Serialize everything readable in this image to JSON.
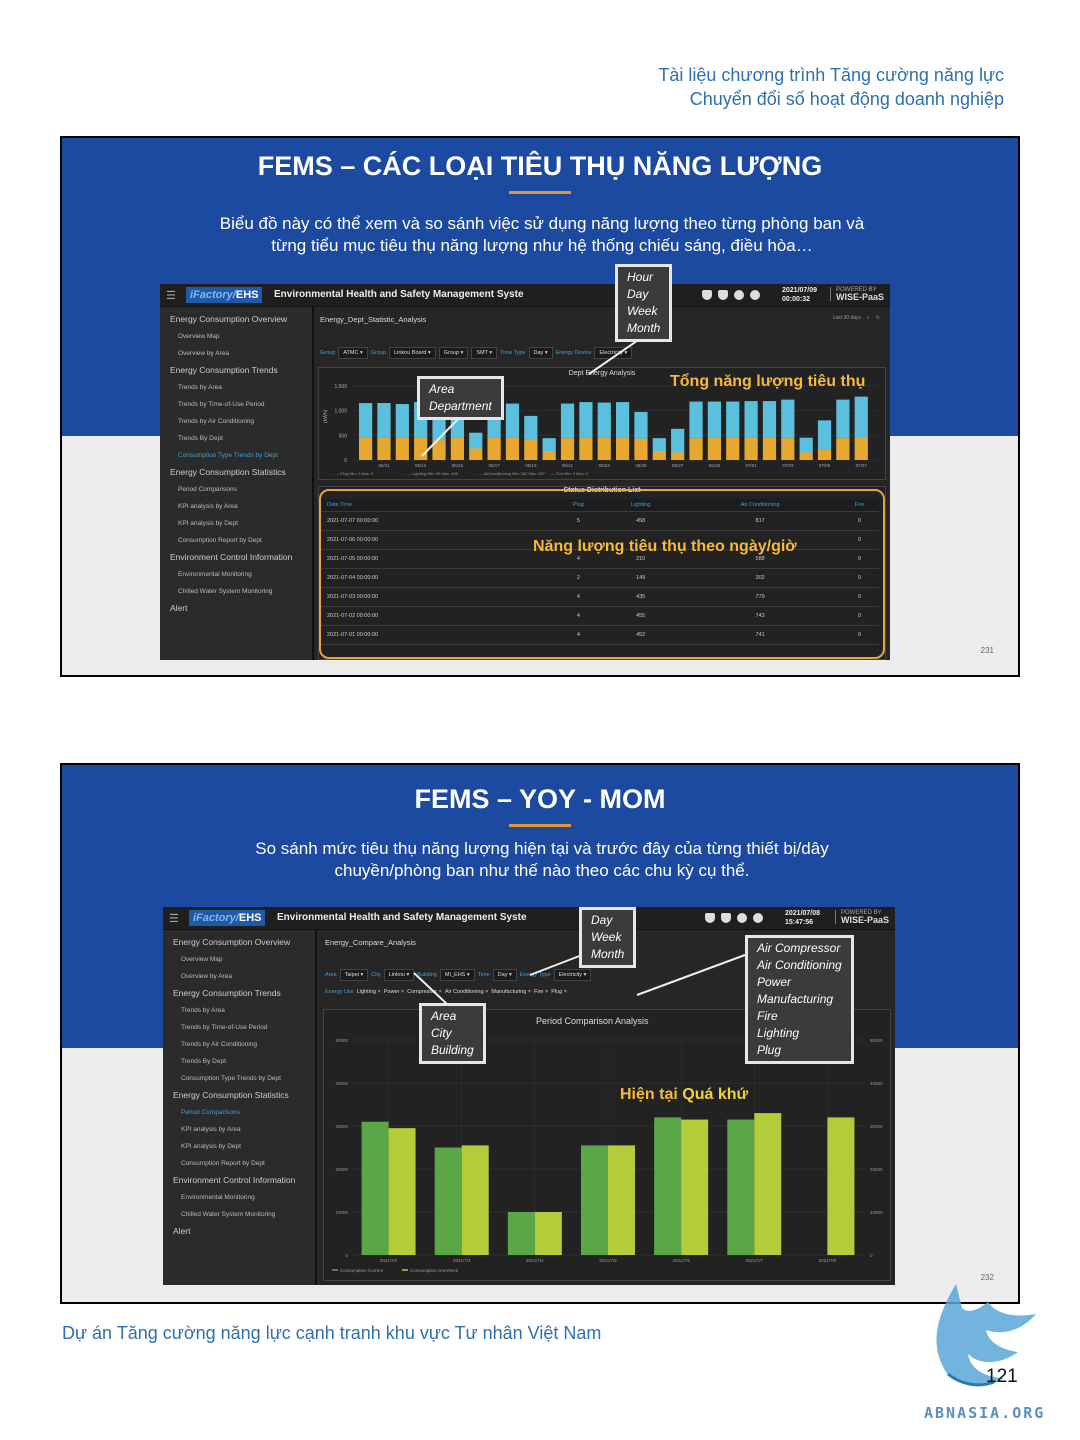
{
  "header": {
    "line1": "Tài liệu chương trình Tăng cường năng lực",
    "line2": "Chuyển đổi số hoạt động doanh nghiệp"
  },
  "footer": {
    "text": "Dự án Tăng cường năng lực cạnh tranh khu vực Tư nhân Việt Nam",
    "page_number": "121",
    "watermark": "ABNASIA.ORG"
  },
  "colors": {
    "band": "#1c4aa0",
    "accent": "#e1963a",
    "callout_text": "#f6b93b",
    "series_cyan": "#5bc0de",
    "series_amber": "#e6a82e",
    "bar_dark": "#5ba646",
    "bar_light": "#b4cc3a"
  },
  "app": {
    "logo_prefix": "iFactory/",
    "logo_suffix": "EHS",
    "title": "Environmental Health and Safety Management Syste",
    "powered_by": "POWERED BY",
    "brand": "WISE-PaaS"
  },
  "slide1": {
    "title": "FEMS – CÁC LOẠI TIÊU THỤ NĂNG LƯỢNG",
    "desc_line1": "Biểu đồ này có thể xem và so sánh việc sử dụng năng lượng theo từng phòng ban và",
    "desc_line2": "từng tiểu mục tiêu thụ năng lượng như hệ thống chiếu sáng, điều hòa…",
    "slide_num": "231",
    "date": "2021/07/09",
    "time": "00:00:32",
    "breadcrumb": "Energy_Dept_Statistic_Analysis",
    "range": "Last 30 days",
    "sidebar": [
      {
        "t": "g",
        "label": "Energy Consumption Overview"
      },
      {
        "t": "i",
        "label": "Overview Map"
      },
      {
        "t": "i",
        "label": "Overview by Area"
      },
      {
        "t": "g",
        "label": "Energy Consumption Trends"
      },
      {
        "t": "i",
        "label": "Trends by Area"
      },
      {
        "t": "i",
        "label": "Trends by Time-of-Use Period"
      },
      {
        "t": "i",
        "label": "Trends by Air Conditioning"
      },
      {
        "t": "i",
        "label": "Trends By Dept"
      },
      {
        "t": "a",
        "label": "Consumption Type Trends by Dept"
      },
      {
        "t": "g",
        "label": "Energy Consumption Statistics"
      },
      {
        "t": "i",
        "label": "Period Comparisons"
      },
      {
        "t": "i",
        "label": "KPI analysis by Area"
      },
      {
        "t": "i",
        "label": "KPI analysis by Dept"
      },
      {
        "t": "i",
        "label": "Consumption Report by Dept"
      },
      {
        "t": "g",
        "label": "Environment Control Information"
      },
      {
        "t": "i",
        "label": "Environmental Monitoring"
      },
      {
        "t": "i",
        "label": "Chilled Water System Monitoring"
      },
      {
        "t": "g",
        "label": "Alert"
      }
    ],
    "filters": [
      {
        "l": "Group",
        "v": "ATMC"
      },
      {
        "l": "Group",
        "v": "Linkou Board"
      },
      {
        "l": "",
        "v": "Group"
      },
      {
        "l": "",
        "v": "SMT"
      },
      {
        "l": "Time Type",
        "v": "Day"
      },
      {
        "l": "Energy Device",
        "v": "Electricity"
      }
    ],
    "callout_time": [
      "Hour",
      "Day",
      "Week",
      "Month"
    ],
    "callout_area": [
      "Area",
      "Department"
    ],
    "label_total": "Tổng năng lượng tiêu thụ",
    "label_daily": "Năng lượng tiêu thụ theo ngày/giờ",
    "table_title": "Status Distribution List",
    "table_headers": [
      "Date Time",
      "Plug",
      "Lighting",
      "Air Conditioning",
      "Fire"
    ],
    "table_rows": [
      [
        "2021-07-07 00:00:00",
        "5",
        "458",
        "817",
        "0"
      ],
      [
        "2021-07-06 00:00:00",
        "",
        "",
        "",
        "0"
      ],
      [
        "2021-07-05 00:00:00",
        "4",
        "210",
        "588",
        "0"
      ],
      [
        "2021-07-04 00:00:00",
        "2",
        "149",
        "302",
        "0"
      ],
      [
        "2021-07-03 00:00:00",
        "4",
        "435",
        "779",
        "0"
      ],
      [
        "2021-07-02 00:00:00",
        "4",
        "455",
        "743",
        "0"
      ],
      [
        "2021-07-01 00:00:00",
        "4",
        "452",
        "741",
        "0"
      ]
    ]
  },
  "slide2": {
    "title": "FEMS – YOY - MOM",
    "desc_line1": "So sánh mức tiêu thụ năng lượng hiện tại và trước đây của từng thiết bị/dây",
    "desc_line2": "chuyền/phòng ban như thế nào theo các chu kỳ cụ thể.",
    "slide_num": "232",
    "date": "2021/07/08",
    "time": "15:47:56",
    "breadcrumb": "Energy_Compare_Analysis",
    "sidebar": [
      {
        "t": "g",
        "label": "Energy Consumption Overview"
      },
      {
        "t": "i",
        "label": "Overview Map"
      },
      {
        "t": "i",
        "label": "Overview by Area"
      },
      {
        "t": "g",
        "label": "Energy Consumption Trends"
      },
      {
        "t": "i",
        "label": "Trends by Area"
      },
      {
        "t": "i",
        "label": "Trends by Time-of-Use Period"
      },
      {
        "t": "i",
        "label": "Trends by Air Conditioning"
      },
      {
        "t": "i",
        "label": "Trends By Dept"
      },
      {
        "t": "i",
        "label": "Consumption Type Trends by Dept"
      },
      {
        "t": "g",
        "label": "Energy Consumption Statistics"
      },
      {
        "t": "a",
        "label": "Period Comparisons"
      },
      {
        "t": "i",
        "label": "KPI analysis by Area"
      },
      {
        "t": "i",
        "label": "KPI analysis by Dept"
      },
      {
        "t": "i",
        "label": "Consumption Report by Dept"
      },
      {
        "t": "g",
        "label": "Environment Control Information"
      },
      {
        "t": "i",
        "label": "Environmental Monitoring"
      },
      {
        "t": "i",
        "label": "Chilled Water System Monitoring"
      },
      {
        "t": "g",
        "label": "Alert"
      }
    ],
    "filters": [
      {
        "l": "Area",
        "v": "Taipei"
      },
      {
        "l": "City",
        "v": "Linkou"
      },
      {
        "l": "Building",
        "v": "MI_EHS"
      },
      {
        "l": "Time",
        "v": "Day"
      },
      {
        "l": "Energy Type",
        "v": "Electricity"
      }
    ],
    "energy_use_label": "Energy Use",
    "energy_use": [
      "Lighting",
      "Power",
      "Compressor",
      "Air Conditioning",
      "Manufacturing",
      "Fire",
      "Plug"
    ],
    "callout_time": [
      "Day",
      "Week",
      "Month"
    ],
    "callout_area": [
      "Area",
      "City",
      "Building"
    ],
    "callout_types": [
      "Air Compressor",
      "Air Conditioning",
      "Power",
      "Manufacturing",
      "Fire",
      "Lighting",
      "Plug"
    ],
    "label_now": "Hiện tại",
    "label_past": "Quá khứ"
  },
  "chart_data": [
    {
      "type": "bar",
      "title": "Dept Energy Analysis",
      "ylabel": "(kWh)",
      "ylim": [
        0,
        1500
      ],
      "yticks": [
        0,
        500,
        1000,
        1500
      ],
      "xticks": [
        "06/11",
        "06/13",
        "06/15",
        "06/17",
        "06/19",
        "06/21",
        "06/23",
        "06/25",
        "06/27",
        "06/29",
        "07/01",
        "07/03",
        "07/05",
        "07/07",
        "07/09"
      ],
      "stacked": true,
      "x": [
        "06/10",
        "06/11",
        "06/12",
        "06/13",
        "06/14",
        "06/15",
        "06/16",
        "06/17",
        "06/18",
        "06/19",
        "06/20",
        "06/21",
        "06/22",
        "06/23",
        "06/24",
        "06/25",
        "06/26",
        "06/27",
        "06/28",
        "06/29",
        "06/30",
        "07/01",
        "07/02",
        "07/03",
        "07/04",
        "07/05",
        "07/06",
        "07/07"
      ],
      "series": [
        {
          "name": "Plug",
          "values": [
            4,
            4,
            4,
            4,
            4,
            4,
            3,
            4,
            4,
            4,
            3,
            4,
            4,
            4,
            4,
            4,
            3,
            2,
            4,
            4,
            4,
            4,
            4,
            4,
            2,
            4,
            4,
            5
          ]
        },
        {
          "name": "AirConditioning",
          "values": [
            700,
            700,
            680,
            720,
            560,
            720,
            320,
            720,
            690,
            470,
            260,
            700,
            720,
            710,
            720,
            540,
            260,
            480,
            740,
            730,
            730,
            740,
            740,
            780,
            300,
            590,
            780,
            820
          ]
        },
        {
          "name": "Lighting",
          "values": [
            450,
            450,
            450,
            450,
            400,
            450,
            230,
            450,
            450,
            420,
            180,
            440,
            450,
            450,
            450,
            430,
            180,
            150,
            440,
            450,
            450,
            450,
            450,
            440,
            150,
            210,
            440,
            460
          ]
        },
        {
          "name": "Fire",
          "values": [
            0,
            0,
            0,
            0,
            0,
            0,
            0,
            0,
            0,
            0,
            0,
            0,
            0,
            0,
            0,
            0,
            0,
            0,
            0,
            0,
            0,
            0,
            0,
            0,
            0,
            0,
            0,
            0
          ]
        }
      ],
      "legend": [
        "Plug Min: 2 Max: 5",
        "Lighting Min: 98 Max: 460",
        "AirConditioning Min: 282 Max: 897",
        "Fire Min: 0 Max: 0"
      ]
    },
    {
      "type": "bar",
      "title": "Period Comparison Analysis",
      "ylim": [
        0,
        50000
      ],
      "yticks": [
        0,
        10000,
        20000,
        30000,
        40000,
        50000
      ],
      "categories": [
        "2021/7/2",
        "2021/7/3",
        "2021/7/4",
        "2021/7/5",
        "2021/7/6",
        "2021/7/7",
        "2021/7/8"
      ],
      "series": [
        {
          "name": "Consumption-Current",
          "values": [
            31000,
            25000,
            10000,
            25500,
            32000,
            31500,
            0
          ]
        },
        {
          "name": "Consumption-OneWeek",
          "values": [
            29500,
            25500,
            10000,
            25500,
            31500,
            33000,
            32000
          ]
        }
      ],
      "legend_position": "bottom-left"
    }
  ]
}
